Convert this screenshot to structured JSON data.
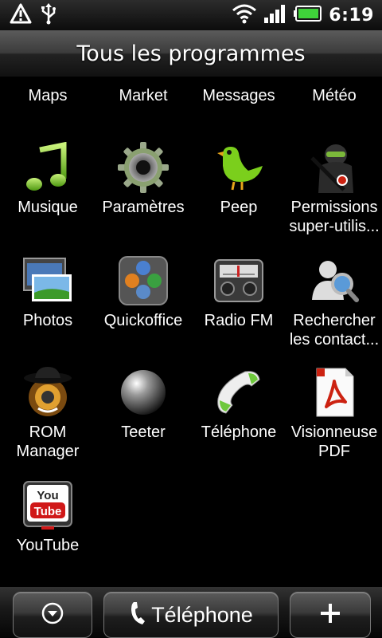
{
  "status_bar": {
    "time": "6:19",
    "icons": [
      "warning-icon",
      "usb-icon",
      "wifi-icon",
      "signal-icon",
      "battery-icon"
    ]
  },
  "header": {
    "title": "Tous les programmes"
  },
  "apps": [
    {
      "label": "Maps",
      "icon": "maps-icon"
    },
    {
      "label": "Market",
      "icon": "market-icon"
    },
    {
      "label": "Messages",
      "icon": "messages-icon"
    },
    {
      "label": "Météo",
      "icon": "weather-icon"
    },
    {
      "label": "Musique",
      "icon": "music-icon"
    },
    {
      "label": "Paramètres",
      "icon": "settings-icon"
    },
    {
      "label": "Peep",
      "icon": "peep-bird-icon"
    },
    {
      "label": "Permissions\nsuper-utilis...",
      "icon": "superuser-icon"
    },
    {
      "label": "Photos",
      "icon": "photos-icon"
    },
    {
      "label": "Quickoffice",
      "icon": "quickoffice-icon"
    },
    {
      "label": "Radio FM",
      "icon": "radio-icon"
    },
    {
      "label": "Rechercher\nles contact...",
      "icon": "contact-search-icon"
    },
    {
      "label": "ROM\nManager",
      "icon": "rom-manager-icon"
    },
    {
      "label": "Teeter",
      "icon": "teeter-ball-icon"
    },
    {
      "label": "Téléphone",
      "icon": "phone-icon"
    },
    {
      "label": "Visionneuse\nPDF",
      "icon": "pdf-icon"
    },
    {
      "label": "YouTube",
      "icon": "youtube-icon"
    }
  ],
  "youtube_icon_text": {
    "top": "You",
    "bottom": "Tube"
  },
  "dock": {
    "left_icon": "collapse-arrow-icon",
    "center_label": "Téléphone",
    "center_icon": "phone-handset-icon",
    "right_icon": "plus-icon"
  },
  "colors": {
    "battery": "#3fd23a",
    "title_bar": "#3c3c3c",
    "background": "#000000"
  }
}
